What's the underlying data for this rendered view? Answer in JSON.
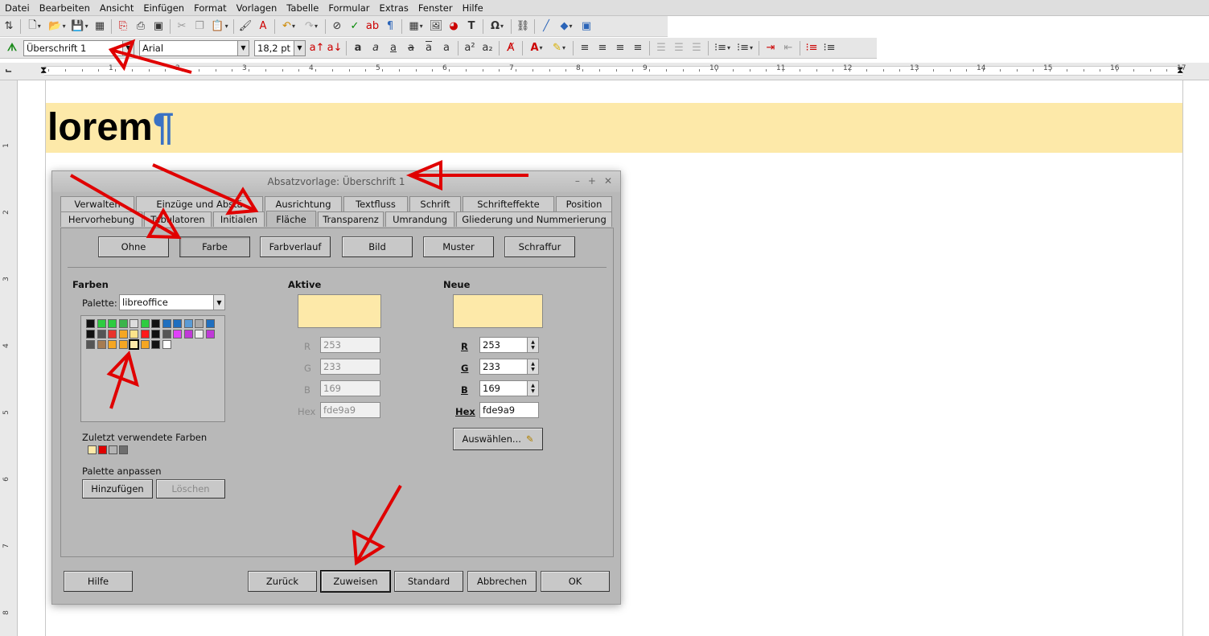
{
  "menubar": [
    "Datei",
    "Bearbeiten",
    "Ansicht",
    "Einfügen",
    "Format",
    "Vorlagen",
    "Tabelle",
    "Formular",
    "Extras",
    "Fenster",
    "Hilfe"
  ],
  "toolbar": {
    "paragraph_style": "Überschrift 1",
    "font_name": "Arial",
    "font_size": "18,2 pt"
  },
  "ruler": {
    "numbers": [
      "1",
      "2",
      "3",
      "4",
      "5",
      "6",
      "7",
      "8",
      "9",
      "10",
      "11",
      "12",
      "13",
      "14",
      "15",
      "16",
      "17"
    ],
    "vertical_numbers": [
      "1",
      "2",
      "3",
      "4",
      "5",
      "6",
      "7",
      "8"
    ]
  },
  "document": {
    "heading_text": "lorem",
    "pilcrow": "¶",
    "heading_bg": "#fde9a9"
  },
  "dialog": {
    "title": "Absatzvorlage: Überschrift 1",
    "win_min": "–",
    "win_max": "+",
    "win_close": "✕",
    "tabs_row1": [
      "Verwalten",
      "Einzüge und Abstä",
      "Ausrichtung",
      "Textfluss",
      "Schrift",
      "Schrifteffekte",
      "Position"
    ],
    "tabs_row2": [
      "Hervorhebung",
      "Tabulatoren",
      "Initialen",
      "Fläche",
      "Transparenz",
      "Umrandung",
      "Gliederung und Nummerierung"
    ],
    "active_tab": "Fläche",
    "fill_buttons": [
      "Ohne",
      "Farbe",
      "Farbverlauf",
      "Bild",
      "Muster",
      "Schraffur"
    ],
    "colors": {
      "heading": "Farben",
      "palette_label": "Palette:",
      "palette_value": "libreoffice",
      "recent_label": "Zuletzt verwendete Farben",
      "recent_colors": [
        "#fde9a9",
        "#e00000",
        "#b4b4b4",
        "#6e6e6e"
      ],
      "customize_label": "Palette anpassen",
      "add_button": "Hinzufügen",
      "delete_button": "Löschen",
      "swatches": [
        [
          "#111111",
          "#2ecc40",
          "#2ecc40",
          "#3cb44b",
          "#dddddd",
          "#2ecc40",
          "#111111",
          "#1f6fbf",
          "#1f6fbf",
          "#5a9bd5",
          "#aaaaaa",
          "#1f6fbf"
        ],
        [
          "#111111",
          "#555555",
          "#e8322c",
          "#f5a623",
          "#fce38a",
          "#ff1a1a",
          "#111111",
          "#555555",
          "#e040fb",
          "#c039d8",
          "#eeeeee",
          "#c039d8"
        ],
        [
          "#555555",
          "#a67c52",
          "#f5a623",
          "#f5a623",
          "#fde9a9",
          "#f5a623",
          "#111111",
          "#ffffff"
        ]
      ]
    },
    "active": {
      "heading": "Aktive",
      "r_label": "R",
      "r_value": "253",
      "g_label": "G",
      "g_value": "233",
      "b_label": "B",
      "b_value": "169",
      "hex_label": "Hex",
      "hex_value": "fde9a9",
      "color": "#fde9a9"
    },
    "new": {
      "heading": "Neue",
      "r_label": "R",
      "r_value": "253",
      "g_label": "G",
      "g_value": "233",
      "b_label": "B",
      "b_value": "169",
      "hex_label": "Hex",
      "hex_value": "fde9a9",
      "pick_button": "Auswählen...",
      "color": "#fde9a9"
    },
    "footer": {
      "help": "Hilfe",
      "back": "Zurück",
      "apply": "Zuweisen",
      "standard": "Standard",
      "cancel": "Abbrechen",
      "ok": "OK"
    }
  },
  "annotation_color": "#e00000"
}
